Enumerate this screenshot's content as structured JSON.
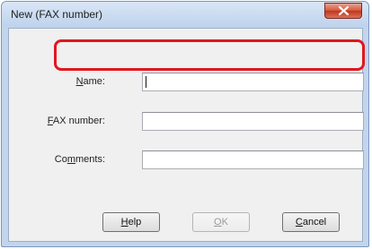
{
  "window": {
    "title": "New (FAX number)",
    "close_icon": "close-icon"
  },
  "form": {
    "name": {
      "label_mnemonic": "N",
      "label_rest": "ame:",
      "value": ""
    },
    "fax_number": {
      "label_mnemonic": "F",
      "label_rest": "AX number:",
      "value": ""
    },
    "comments": {
      "label_pre": "Co",
      "label_mnemonic": "m",
      "label_rest": "ments:",
      "value": ""
    }
  },
  "buttons": {
    "help": {
      "mnemonic": "H",
      "rest": "elp"
    },
    "ok": {
      "mnemonic": "O",
      "rest": "K",
      "enabled": false
    },
    "cancel": {
      "mnemonic": "C",
      "rest": "ancel"
    }
  },
  "colors": {
    "highlight": "#e1161f",
    "title_bar": "#c2d5ec",
    "close_button": "#c9452a"
  }
}
